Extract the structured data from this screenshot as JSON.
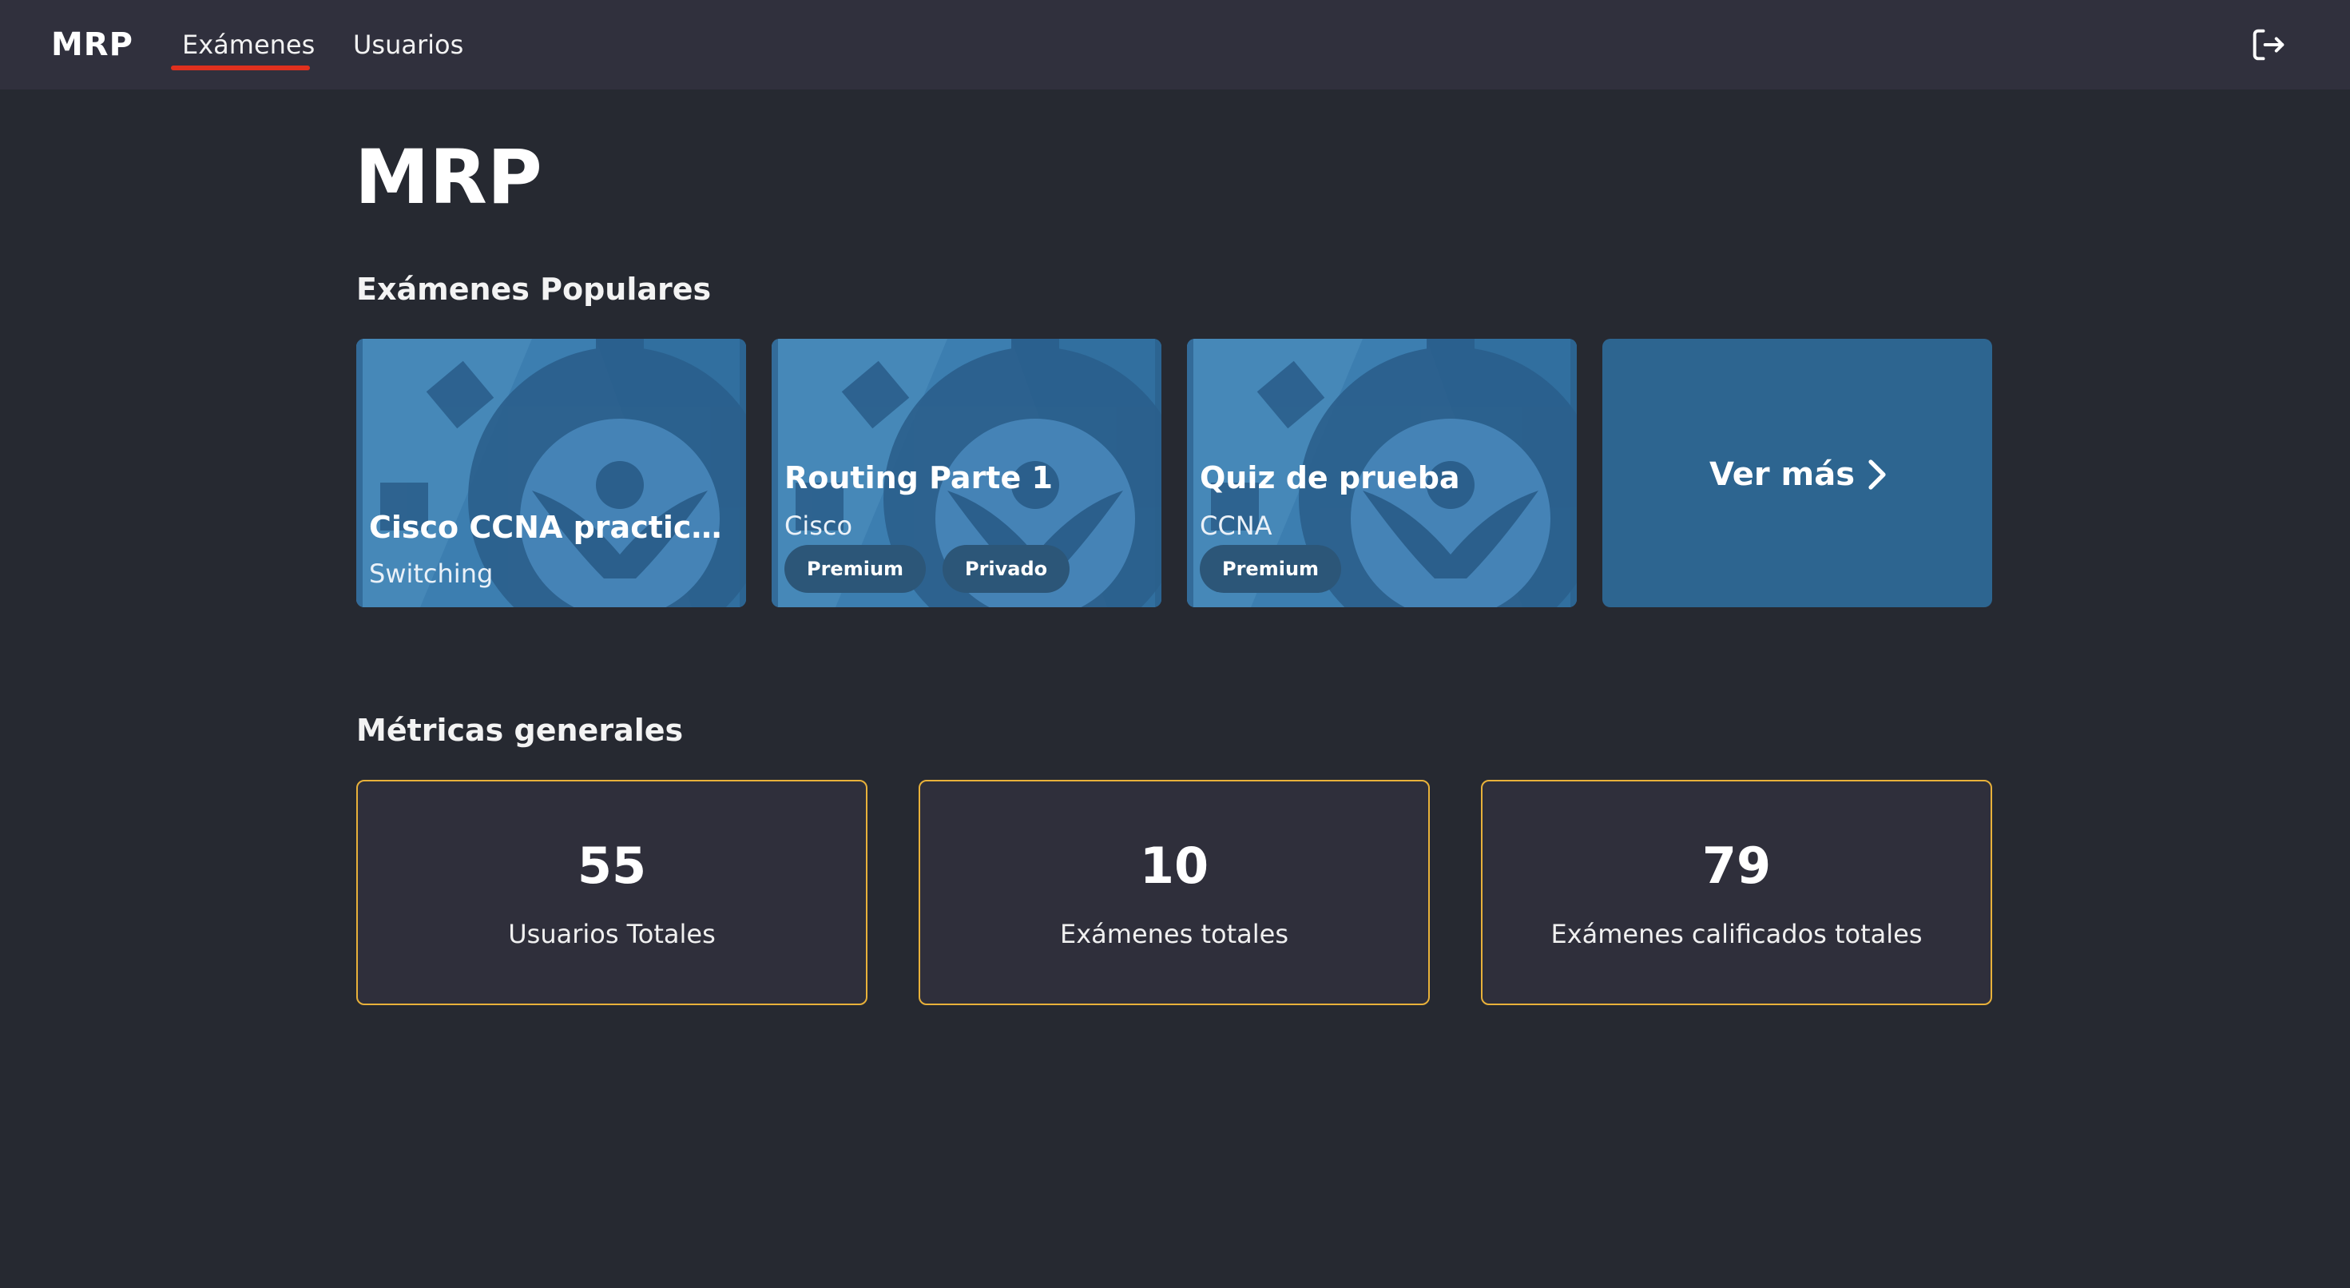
{
  "nav": {
    "brand": "MRP",
    "tabs": [
      {
        "label": "Exámenes",
        "active": true
      },
      {
        "label": "Usuarios",
        "active": false
      }
    ],
    "logout_icon": "logout-icon",
    "active_color": "#e0301e"
  },
  "page": {
    "title": "MRP"
  },
  "popular": {
    "heading": "Exámenes Populares",
    "cards": [
      {
        "title": "Cisco CCNA practice ...",
        "subtitle": "Switching",
        "badges": []
      },
      {
        "title": "Routing Parte 1",
        "subtitle": "Cisco",
        "badges": [
          "Premium",
          "Privado"
        ]
      },
      {
        "title": "Quiz de prueba",
        "subtitle": "CCNA",
        "badges": [
          "Premium"
        ]
      }
    ],
    "more_label": "Ver más",
    "more_icon": "chevron-right-icon",
    "card_color": "#2f6f9f"
  },
  "metrics": {
    "heading": "Métricas generales",
    "items": [
      {
        "value": "55",
        "label": "Usuarios Totales"
      },
      {
        "value": "10",
        "label": "Exámenes totales"
      },
      {
        "value": "79",
        "label": "Exámenes calificados totales"
      }
    ],
    "border_color": "#e8b13a"
  }
}
